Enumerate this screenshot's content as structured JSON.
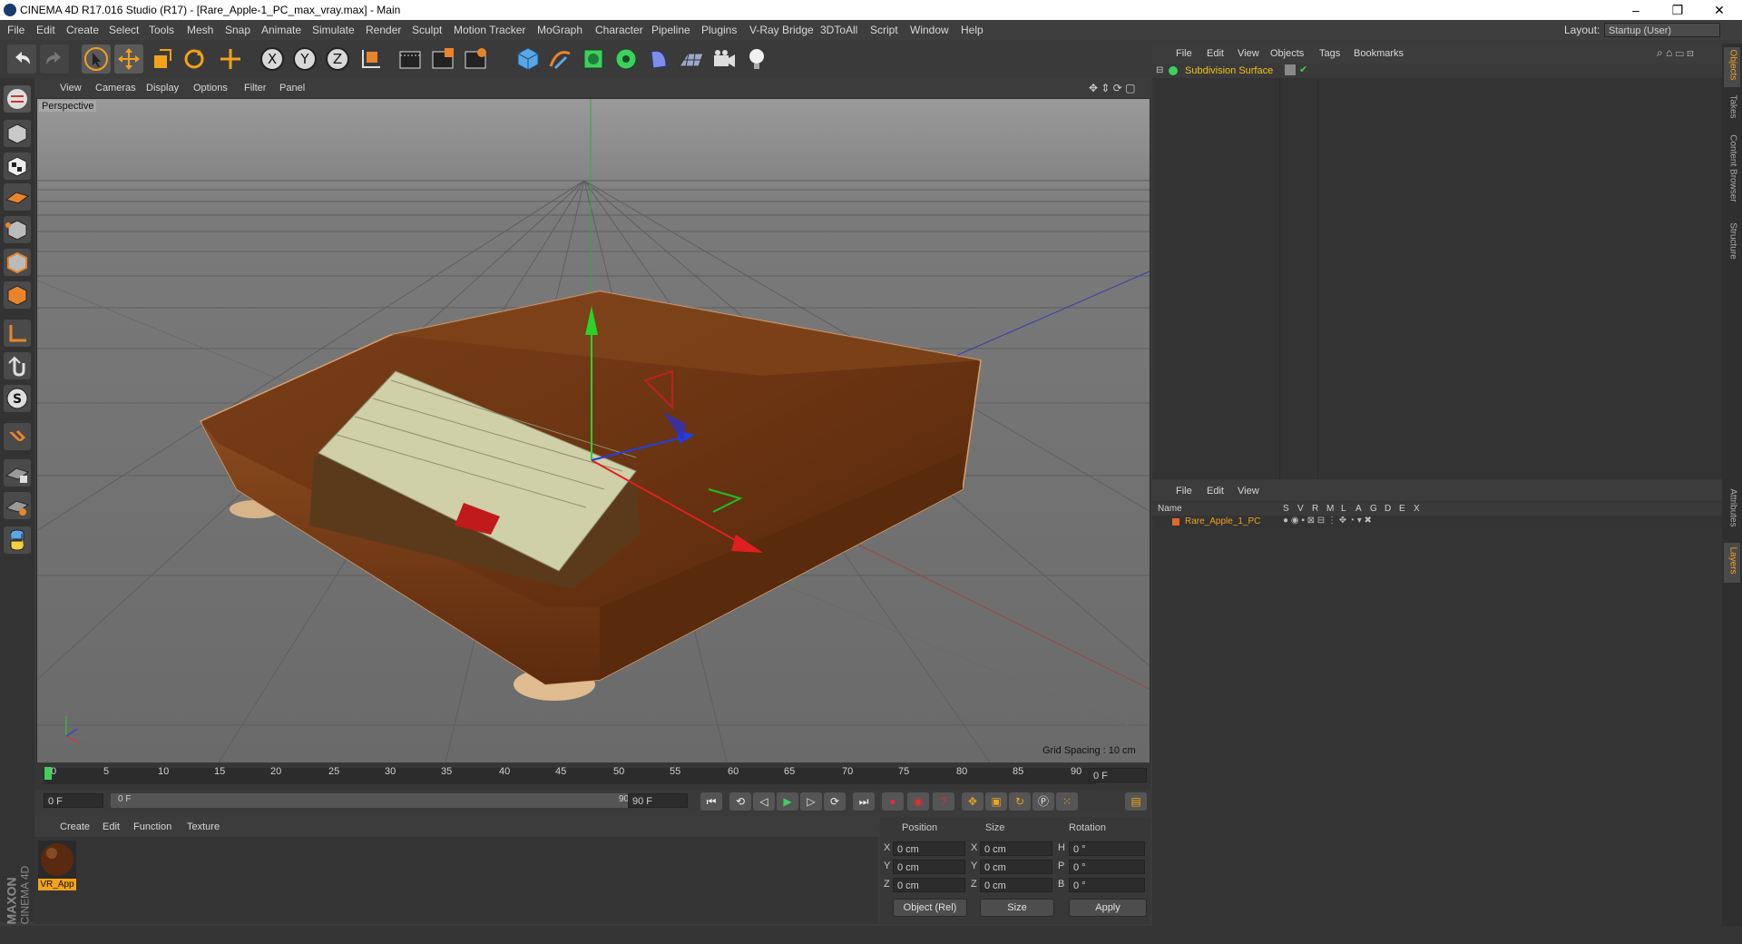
{
  "window": {
    "title": "CINEMA 4D R17.016 Studio (R17) - [Rare_Apple-1_PC_max_vray.max] - Main",
    "minimize": "–",
    "maximize": "❐",
    "close": "✕"
  },
  "menubar": {
    "items": [
      "File",
      "Edit",
      "Create",
      "Select",
      "Tools",
      "Mesh",
      "Snap",
      "Animate",
      "Simulate",
      "Render",
      "Sculpt",
      "Motion Tracker",
      "MoGraph",
      "Character",
      "Pipeline",
      "Plugins",
      "V-Ray Bridge",
      "3DToAll",
      "Script",
      "Window",
      "Help"
    ],
    "layout_label": "Layout:",
    "layout_value": "Startup (User)"
  },
  "toolbar": {
    "axis_x": "X",
    "axis_y": "Y",
    "axis_z": "Z"
  },
  "viewport": {
    "menu": [
      "View",
      "Cameras",
      "Display",
      "Options",
      "Filter",
      "Panel"
    ],
    "label": "Perspective",
    "grid_spacing": "Grid Spacing : 10 cm"
  },
  "timeline": {
    "ticks": [
      "0",
      "5",
      "10",
      "15",
      "20",
      "25",
      "30",
      "35",
      "40",
      "45",
      "50",
      "55",
      "60",
      "65",
      "70",
      "75",
      "80",
      "85",
      "90"
    ],
    "current_frame": "0 F",
    "start_frame": "0 F",
    "range_start": "0 F",
    "range_end": "90 F",
    "end_frame": "90 F"
  },
  "material_manager": {
    "menu": [
      "Create",
      "Edit",
      "Function",
      "Texture"
    ],
    "material_name": "VR_App"
  },
  "coords": {
    "headers": [
      "Position",
      "Size",
      "Rotation"
    ],
    "rows": [
      {
        "axis": "X",
        "pos": "0 cm",
        "size_axis": "X",
        "size": "0 cm",
        "rot_axis": "H",
        "rot": "0 °"
      },
      {
        "axis": "Y",
        "pos": "0 cm",
        "size_axis": "Y",
        "size": "0 cm",
        "rot_axis": "P",
        "rot": "0 °"
      },
      {
        "axis": "Z",
        "pos": "0 cm",
        "size_axis": "Z",
        "size": "0 cm",
        "rot_axis": "B",
        "rot": "0 °"
      }
    ],
    "mode": "Object (Rel)",
    "size_mode": "Size",
    "apply": "Apply"
  },
  "object_manager": {
    "menu": [
      "File",
      "Edit",
      "View",
      "Objects",
      "Tags",
      "Bookmarks"
    ],
    "object_name": "Subdivision Surface"
  },
  "layer_manager": {
    "menu": [
      "File",
      "Edit",
      "View"
    ],
    "col_name": "Name",
    "columns": [
      "S",
      "V",
      "R",
      "M",
      "L",
      "A",
      "G",
      "D",
      "E",
      "X"
    ],
    "layer_name": "Rare_Apple_1_PC"
  },
  "right_tabs": [
    "Objects",
    "Takes",
    "Content Browser",
    "Structure",
    "Attributes",
    "Layers"
  ],
  "branding": {
    "line1": "MAXON",
    "line2": "CINEMA 4D"
  },
  "colors": {
    "accent": "#f2a21b",
    "object_green": "#3ecf5e",
    "layer_orange": "#e0682a"
  }
}
